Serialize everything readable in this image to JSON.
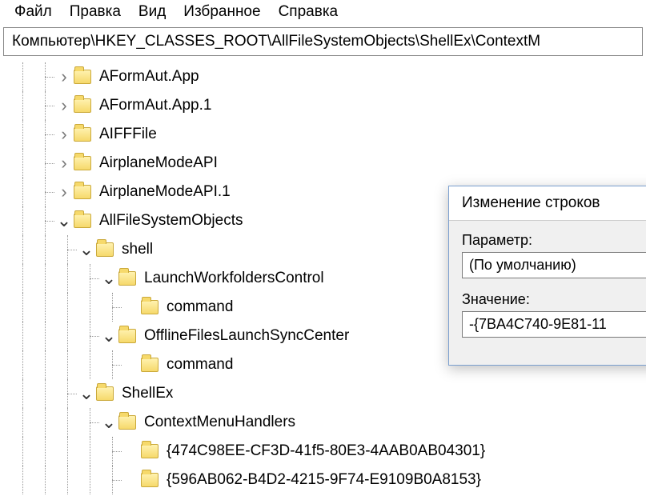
{
  "menu": {
    "items": [
      "Файл",
      "Правка",
      "Вид",
      "Избранное",
      "Справка"
    ]
  },
  "address": "Компьютер\\HKEY_CLASSES_ROOT\\AllFileSystemObjects\\ShellEx\\ContextM",
  "tree": [
    {
      "depth": 0,
      "exp": ">",
      "label": "AFormAut.App"
    },
    {
      "depth": 0,
      "exp": ">",
      "label": "AFormAut.App.1"
    },
    {
      "depth": 0,
      "exp": ">",
      "label": "AIFFFile"
    },
    {
      "depth": 0,
      "exp": ">",
      "label": "AirplaneModeAPI"
    },
    {
      "depth": 0,
      "exp": ">",
      "label": "AirplaneModeAPI.1"
    },
    {
      "depth": 0,
      "exp": "v",
      "label": "AllFileSystemObjects"
    },
    {
      "depth": 1,
      "exp": "v",
      "label": "shell"
    },
    {
      "depth": 2,
      "exp": "v",
      "label": "LaunchWorkfoldersControl"
    },
    {
      "depth": 3,
      "exp": "",
      "label": "command"
    },
    {
      "depth": 2,
      "exp": "v",
      "label": "OfflineFilesLaunchSyncCenter"
    },
    {
      "depth": 3,
      "exp": "",
      "label": "command"
    },
    {
      "depth": 1,
      "exp": "v",
      "label": "ShellEx"
    },
    {
      "depth": 2,
      "exp": "v",
      "label": "ContextMenuHandlers"
    },
    {
      "depth": 3,
      "exp": "",
      "label": "{474C98EE-CF3D-41f5-80E3-4AAB0AB04301}"
    },
    {
      "depth": 3,
      "exp": "",
      "label": "{596AB062-B4D2-4215-9F74-E9109B0A8153}"
    }
  ],
  "dialog": {
    "title": "Изменение строков",
    "param_label": "Параметр:",
    "param_value": "(По умолчанию)",
    "value_label": "Значение:",
    "value_value": "-{7BA4C740-9E81-11"
  }
}
